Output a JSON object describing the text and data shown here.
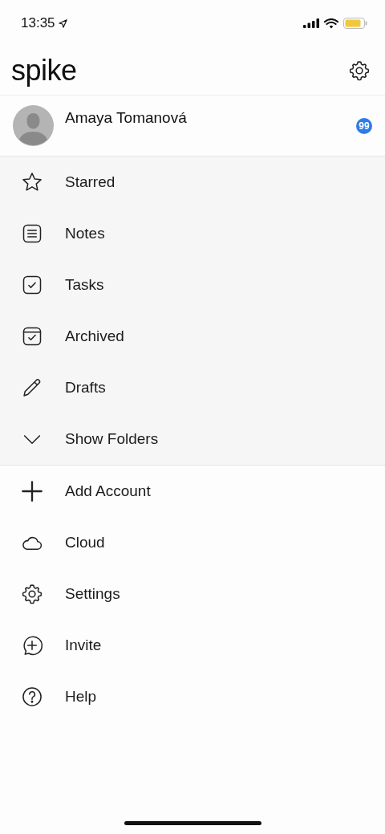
{
  "status_bar": {
    "time": "13:35"
  },
  "header": {
    "logo": "spike"
  },
  "account": {
    "name": "Amaya Tomanová",
    "badge": "99"
  },
  "primary_menu": [
    {
      "label": "Starred"
    },
    {
      "label": "Notes"
    },
    {
      "label": "Tasks"
    },
    {
      "label": "Archived"
    },
    {
      "label": "Drafts"
    },
    {
      "label": "Show Folders"
    }
  ],
  "secondary_menu": [
    {
      "label": "Add Account"
    },
    {
      "label": "Cloud"
    },
    {
      "label": "Settings"
    },
    {
      "label": "Invite"
    },
    {
      "label": "Help"
    }
  ]
}
